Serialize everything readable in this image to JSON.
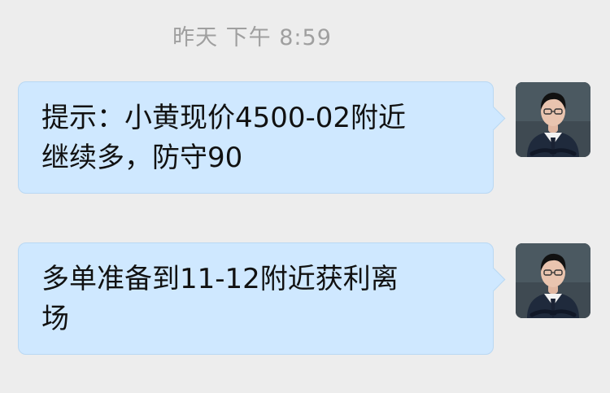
{
  "timestamp": "昨天  下午 8:59",
  "messages": [
    {
      "lines": [
        "提示：小黄现价4500-02附近",
        "继续多，防守90"
      ],
      "avatar_icon": "user-avatar-icon"
    },
    {
      "lines": [
        "多单准备到11-12附近获利离",
        "场"
      ],
      "avatar_icon": "user-avatar-icon"
    }
  ],
  "colors": {
    "background": "#ededed",
    "bubble": "#cfe8ff",
    "timestamp_text": "#9f9f9f",
    "message_text": "#111111"
  }
}
